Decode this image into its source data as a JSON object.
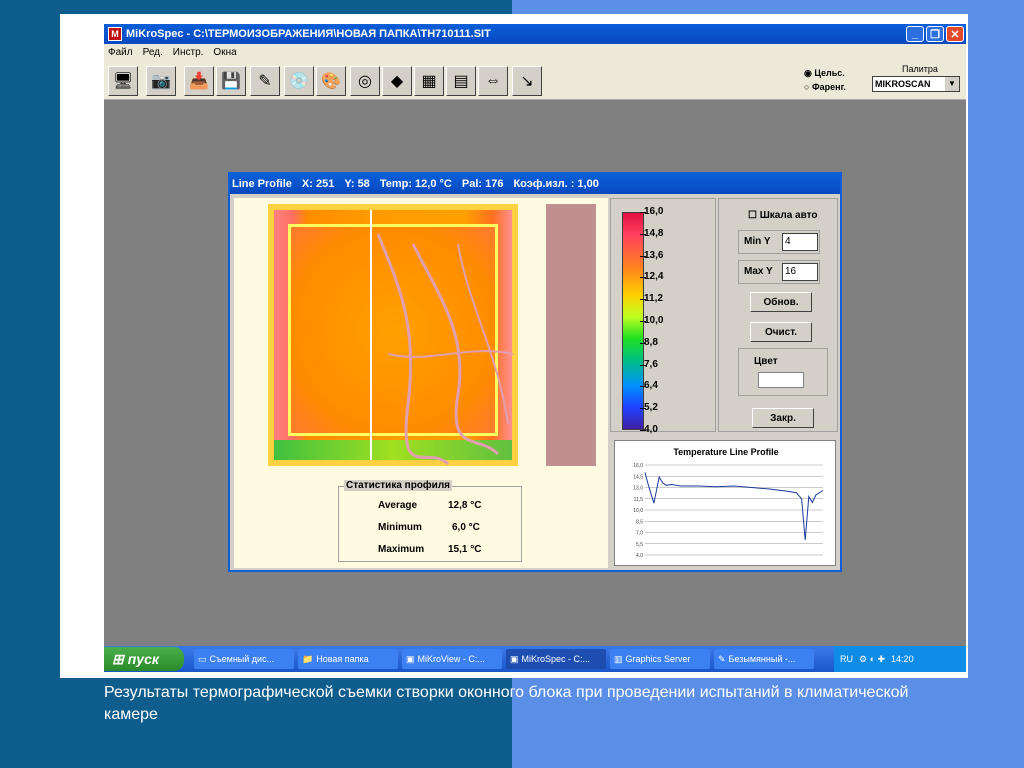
{
  "app": {
    "title": "MiKroSpec - C:\\ТЕРМОИЗОБРАЖЕНИЯ\\НОВАЯ ПАПКА\\TH710111.SIT",
    "icon_letter": "M"
  },
  "menu": [
    "Файл",
    "Ред.",
    "Инстр.",
    "Окна"
  ],
  "toolbar": {
    "units": {
      "celsius": "Цельс.",
      "fahrenheit": "Фаренг."
    },
    "palette_label": "Палитра",
    "palette_value": "MIKROSCAN"
  },
  "line_profile": {
    "title": "Line Profile",
    "x": "X: 251",
    "y": "Y: 58",
    "temp": "Temp: 12,0 °C",
    "pal": "Pal: 176",
    "emiss": "Коэф.изл. : 1,00",
    "scale_ticks": [
      "16,0",
      "14,8",
      "13,6",
      "12,4",
      "11,2",
      "10,0",
      "8,8",
      "7,6",
      "6,4",
      "5,2",
      "4,0"
    ],
    "auto_scale": "Шкала авто",
    "min_y_label": "Min Y",
    "min_y_value": "4",
    "max_y_label": "Max Y",
    "max_y_value": "16",
    "refresh_btn": "Обнов.",
    "clear_btn": "Очист.",
    "color_label": "Цвет",
    "close_btn": "Закр.",
    "stats": {
      "title": "Статистика профиля",
      "rows": [
        {
          "label": "Average",
          "value": "12,8 °C"
        },
        {
          "label": "Minimum",
          "value": "6,0 °C"
        },
        {
          "label": "Maximum",
          "value": "15,1 °C"
        }
      ]
    }
  },
  "chart_data": {
    "type": "line",
    "title": "Temperature Line Profile",
    "yticks": [
      "16,0",
      "14,5",
      "13,0",
      "11,5",
      "10,0",
      "8,5",
      "7,0",
      "5,5",
      "4,0"
    ],
    "ylim": [
      4,
      16
    ],
    "series": [
      {
        "x": [
          0,
          2,
          5,
          8,
          10,
          12,
          15,
          20,
          30,
          40,
          50,
          60,
          70,
          80,
          85,
          88,
          90,
          92,
          94,
          96,
          100
        ],
        "values": [
          15.0,
          13.2,
          10.9,
          14.4,
          13.6,
          13.3,
          13.4,
          13.2,
          13.2,
          13.1,
          13.2,
          13.0,
          12.8,
          12.5,
          12.3,
          11.5,
          6.0,
          11.8,
          11.0,
          12.0,
          12.6
        ]
      }
    ]
  },
  "taskbar": {
    "start": "пуск",
    "tasks": [
      "Съемный дис...",
      "Новая папка",
      "MiKroView - C:...",
      "MiKroSpec - C:...",
      "Graphics Server",
      "Безымянный -..."
    ],
    "lang": "RU",
    "time": "14:20"
  },
  "caption": "Результаты термографической съемки створки оконного блока при проведении испытаний в климатической камере"
}
